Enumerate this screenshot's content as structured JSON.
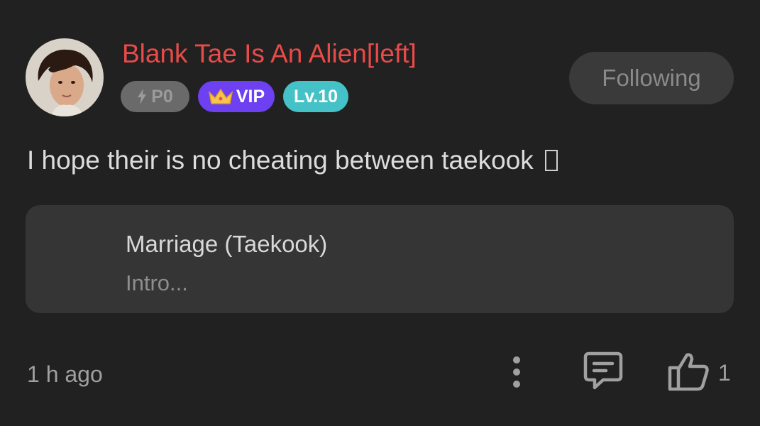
{
  "post": {
    "author": {
      "name": "Blank Tae Is An Alien[left]",
      "name_color": "#ea4a48",
      "avatar": "profile-photo"
    },
    "badges": {
      "points": {
        "icon": "lightning-icon",
        "label": "P0"
      },
      "vip": {
        "icon": "crown-icon",
        "label": "VIP",
        "color": "#6d40f1"
      },
      "level": {
        "label": "Lv.10",
        "color": "#45c2c7"
      }
    },
    "follow_button": {
      "label": "Following"
    },
    "text": "I hope their is no cheating between taekook",
    "linked_story": {
      "title": "Marriage (Taekook)",
      "subtitle": "Intro..."
    },
    "footer": {
      "timestamp": "1 h ago",
      "more_icon": "vertical-dots-icon",
      "comment_icon": "comment-icon",
      "like_icon": "thumbs-up-icon",
      "like_count": "1"
    }
  }
}
